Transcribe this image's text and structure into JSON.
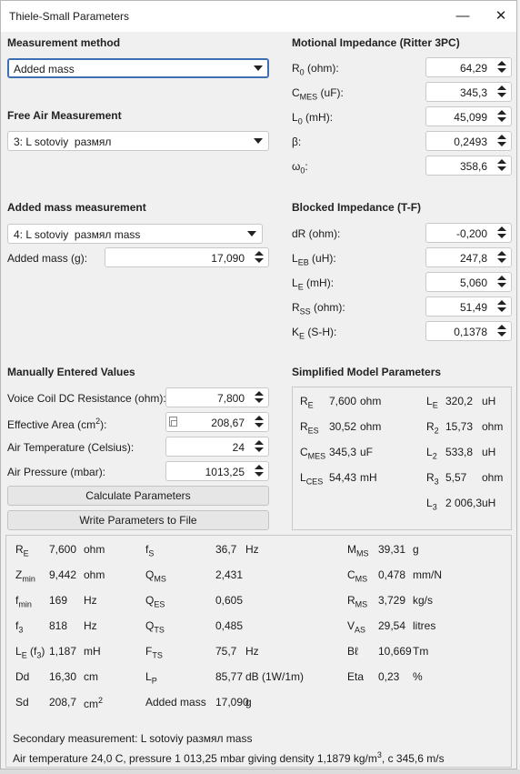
{
  "window": {
    "title": "Thiele-Small Parameters",
    "minimize_icon": "minimize-icon",
    "close_icon": "close-icon"
  },
  "measurement_method": {
    "heading": "Measurement method",
    "selected": "Added mass"
  },
  "free_air": {
    "heading": "Free Air Measurement",
    "selected": "3: L sotoviy  размял"
  },
  "added_mass_meas": {
    "heading": "Added mass measurement",
    "selected": "4: L sotoviy  размял mass",
    "mass_label": "Added mass (g):",
    "mass_value": "17,090"
  },
  "motional": {
    "heading": "Motional Impedance (Ritter 3PC)",
    "rows": [
      {
        "label": "R",
        "sub": "0",
        "unit": " (ohm):",
        "value": "64,29"
      },
      {
        "label": "C",
        "sub": "MES",
        "unit": " (uF):",
        "value": "345,3"
      },
      {
        "label": "L",
        "sub": "0",
        "unit": " (mH):",
        "value": "45,099"
      },
      {
        "label": "β:",
        "sub": "",
        "unit": "",
        "value": "0,2493"
      },
      {
        "label": "ω",
        "sub": "0",
        "unit": ":",
        "value": "358,6"
      }
    ]
  },
  "blocked": {
    "heading": "Blocked Impedance (T-F)",
    "rows": [
      {
        "label": "dR (ohm):",
        "sub": "",
        "unit": "",
        "value": "-0,200"
      },
      {
        "label": "L",
        "sub": "EB",
        "unit": " (uH):",
        "value": "247,8"
      },
      {
        "label": "L",
        "sub": "E",
        "unit": " (mH):",
        "value": "5,060"
      },
      {
        "label": "R",
        "sub": "SS",
        "unit": " (ohm):",
        "value": "51,49"
      },
      {
        "label": "K",
        "sub": "E",
        "unit": " (S-H):",
        "value": "0,1378"
      }
    ]
  },
  "manual": {
    "heading": "Manually Entered Values",
    "vc_label": "Voice Coil DC Resistance (ohm):",
    "vc_value": "7,800",
    "area_label": "Effective Area (cm",
    "area_sup": "2",
    "area_end": "):",
    "area_value": "208,67",
    "temp_label": "Air Temperature (Celsius):",
    "temp_value": "24",
    "press_label": "Air Pressure (mbar):",
    "press_value": "1013,25"
  },
  "buttons": {
    "calculate": "Calculate Parameters",
    "write": "Write Parameters to File"
  },
  "simplified": {
    "heading": "Simplified Model Parameters",
    "left": [
      {
        "sym": "R",
        "sub": "E",
        "val": "7,600",
        "unit": "ohm"
      },
      {
        "sym": "R",
        "sub": "ES",
        "val": "30,52",
        "unit": "ohm"
      },
      {
        "sym": "C",
        "sub": "MES",
        "val": "345,3",
        "unit": "uF"
      },
      {
        "sym": "L",
        "sub": "CES",
        "val": "54,43",
        "unit": "mH"
      }
    ],
    "right": [
      {
        "sym": "L",
        "sub": "E",
        "val": "320,2",
        "unit": "uH"
      },
      {
        "sym": "R",
        "sub": "2",
        "val": "15,73",
        "unit": "ohm"
      },
      {
        "sym": "L",
        "sub": "2",
        "val": "533,8",
        "unit": "uH"
      },
      {
        "sym": "R",
        "sub": "3",
        "val": "5,57",
        "unit": "ohm"
      },
      {
        "sym": "L",
        "sub": "3",
        "val": "2 006,3",
        "unit": "uH"
      }
    ]
  },
  "results": {
    "col1": [
      {
        "sym": "R",
        "sub": "E",
        "val": "7,600",
        "unit": "ohm"
      },
      {
        "sym": "Z",
        "sub": "min",
        "val": "9,442",
        "unit": "ohm"
      },
      {
        "sym": "f",
        "sub": "min",
        "val": "169",
        "unit": "Hz"
      },
      {
        "sym": "f",
        "sub": "3",
        "val": "818",
        "unit": "Hz"
      },
      {
        "sym": "L",
        "sub": "E",
        "extra": " (f",
        "extra_sub": "3",
        "extra_end": ")",
        "val": "1,187",
        "unit": "mH"
      },
      {
        "sym": "Dd",
        "sub": "",
        "val": "16,30",
        "unit": "cm"
      },
      {
        "sym": "Sd",
        "sub": "",
        "val": "208,7",
        "unit": "cm",
        "unit_sup": "2"
      }
    ],
    "col2": [
      {
        "sym": "f",
        "sub": "S",
        "val": "36,7",
        "unit": "Hz"
      },
      {
        "sym": "Q",
        "sub": "MS",
        "val": "2,431",
        "unit": ""
      },
      {
        "sym": "Q",
        "sub": "ES",
        "val": "0,605",
        "unit": ""
      },
      {
        "sym": "Q",
        "sub": "TS",
        "val": "0,485",
        "unit": ""
      },
      {
        "sym": "F",
        "sub": "TS",
        "val": "75,7",
        "unit": "Hz"
      },
      {
        "sym": "L",
        "sub": "P",
        "val": "85,77",
        "unit": "dB (1W/1m)"
      },
      {
        "sym": "Added mass",
        "sub": "",
        "val": "17,090",
        "unit": "g"
      }
    ],
    "col3": [
      {
        "sym": "M",
        "sub": "MS",
        "val": "39,31",
        "unit": "g"
      },
      {
        "sym": "C",
        "sub": "MS",
        "val": "0,478",
        "unit": "mm/N"
      },
      {
        "sym": "R",
        "sub": "MS",
        "val": "3,729",
        "unit": "kg/s"
      },
      {
        "sym": "V",
        "sub": "AS",
        "val": "29,54",
        "unit": "litres"
      },
      {
        "sym": "Bℓ",
        "sub": "",
        "val": "10,669",
        "unit": "Tm"
      },
      {
        "sym": "Eta",
        "sub": "",
        "val": "0,23",
        "unit": "%"
      }
    ],
    "footer1": "Secondary measurement: L sotoviy размял mass",
    "footer2a": "Air temperature 24,0 C, pressure 1 013,25 mbar giving density 1,1879 kg/m",
    "footer2sup": "3",
    "footer2b": ", c 345,6 m/s"
  }
}
